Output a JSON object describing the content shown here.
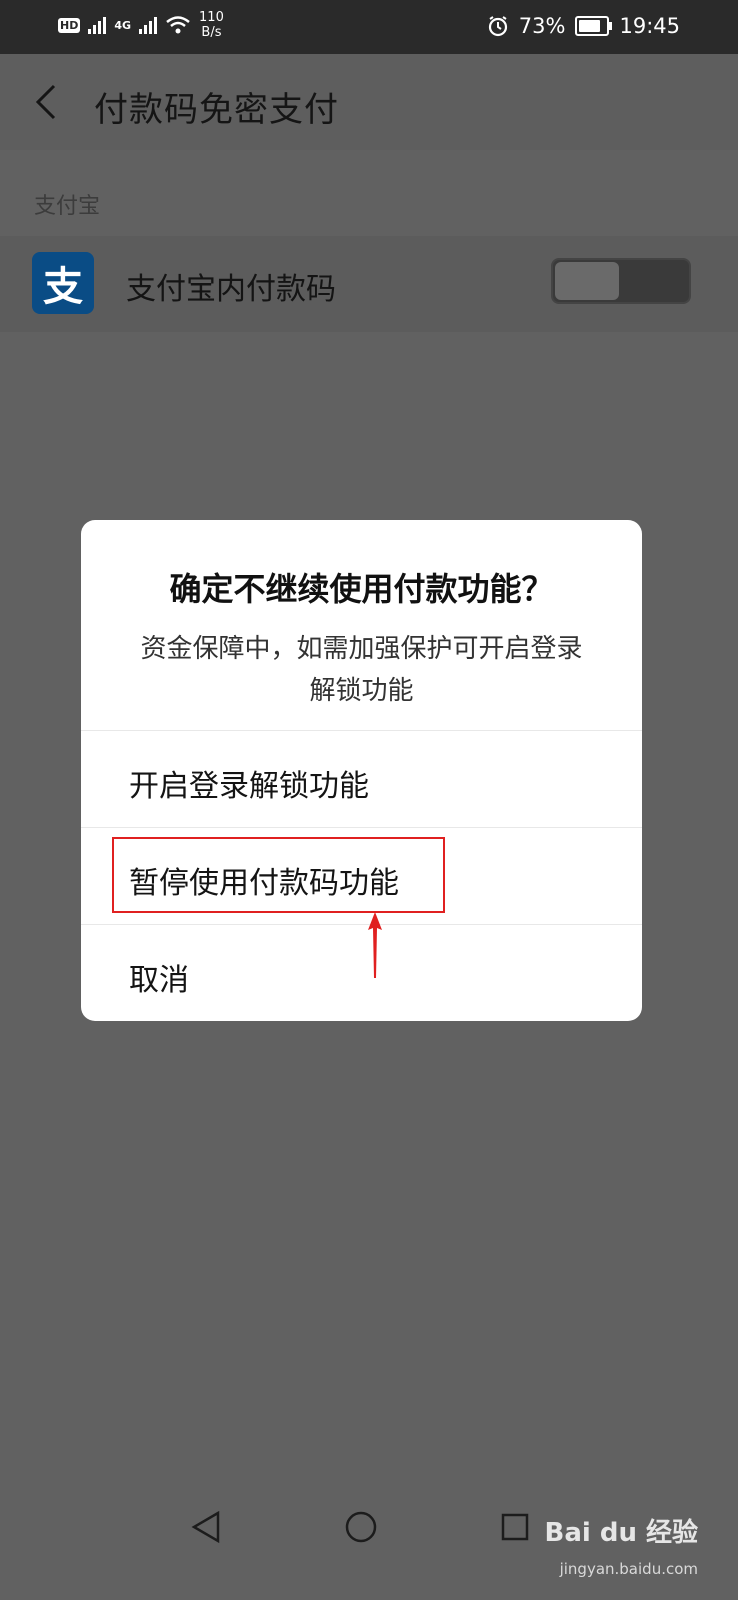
{
  "status_bar": {
    "left_badge": "HD",
    "network_type": "4G",
    "speed_value": "110",
    "speed_unit": "B/s",
    "battery_percent": "73%",
    "time": "19:45"
  },
  "header": {
    "title": "付款码免密支付"
  },
  "section": {
    "label": "支付宝"
  },
  "row": {
    "app_icon_glyph": "支",
    "label": "支付宝内付款码",
    "toggle_on": true
  },
  "dialog": {
    "title": "确定不继续使用付款功能？",
    "message": "资金保障中，如需加强保护可开启登录解锁功能",
    "options": [
      {
        "label": "开启登录解锁功能"
      },
      {
        "label": "暂停使用付款码功能"
      },
      {
        "label": "取消"
      }
    ]
  },
  "nav_bar": {
    "back": "back-triangle-icon",
    "home": "home-circle-icon",
    "recents": "recents-square-icon"
  },
  "watermark": {
    "brand": "Bai du 经验",
    "url": "jingyan.baidu.com"
  },
  "colors": {
    "alipay_blue": "#0a4c85",
    "highlight_red": "#e02020",
    "overlay": "#616161"
  }
}
